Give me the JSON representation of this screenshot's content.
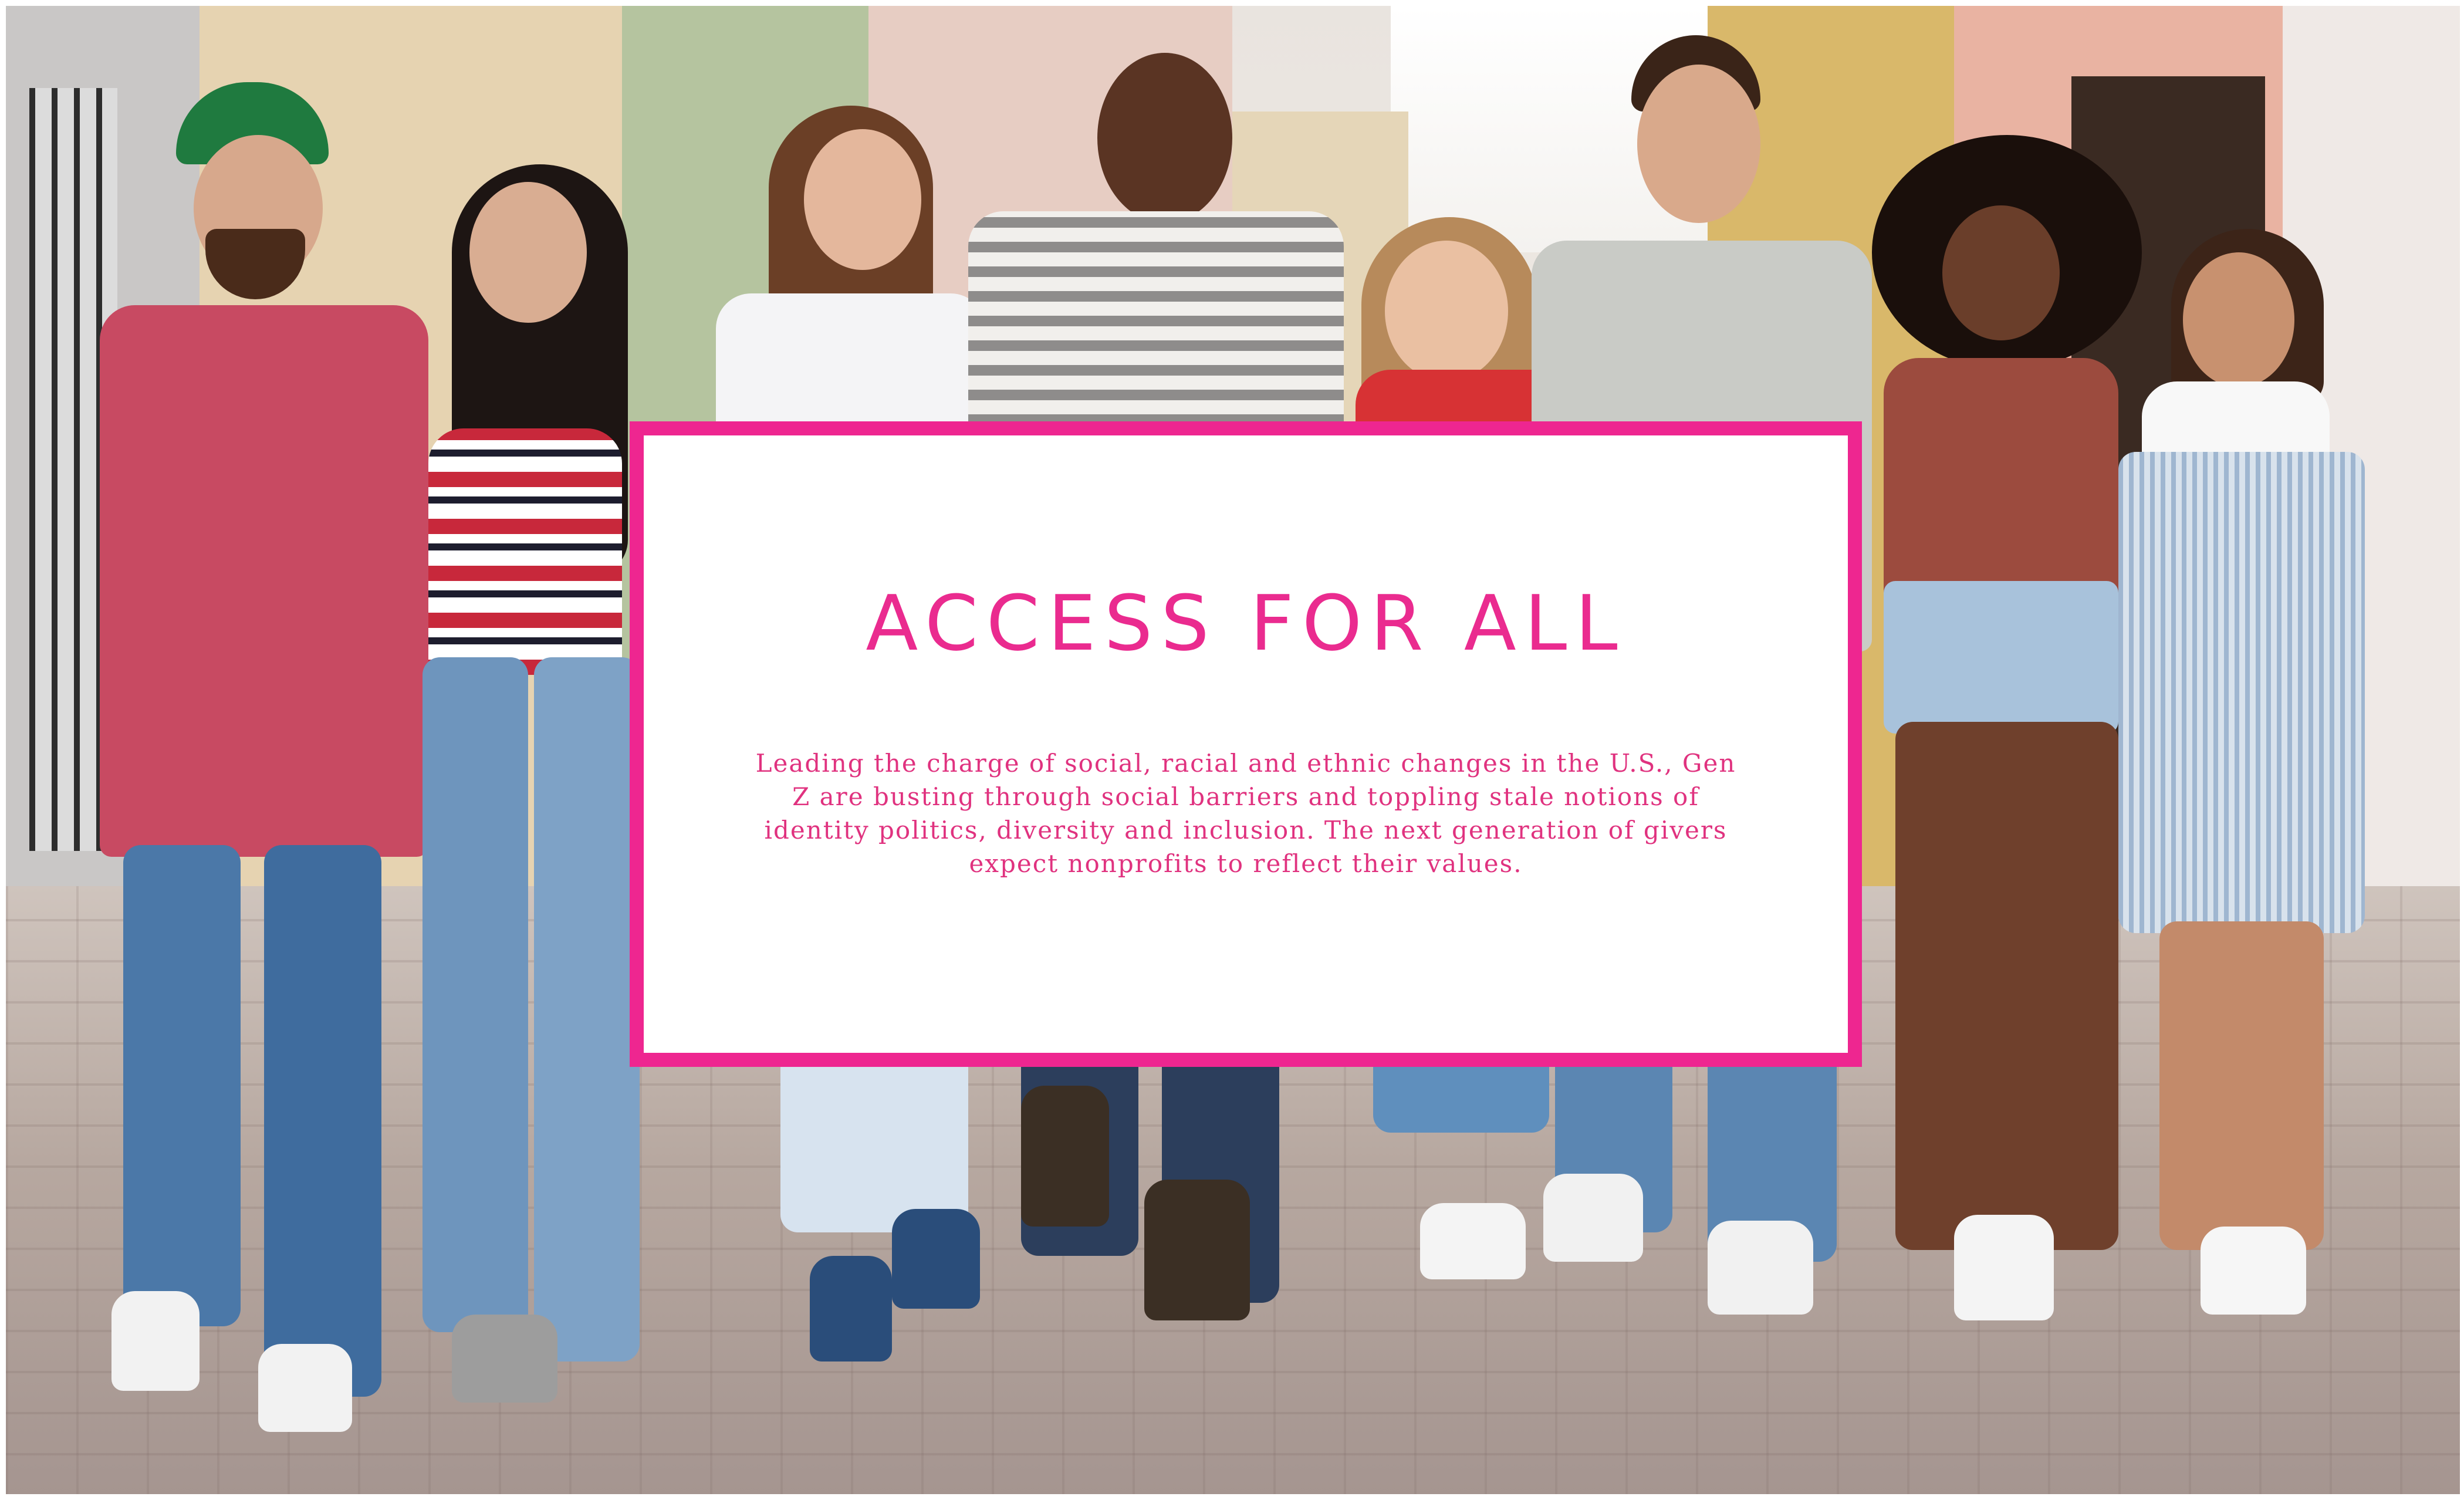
{
  "card": {
    "title": "ACCESS FOR ALL",
    "body": "Leading the charge of social, racial and ethnic changes in the U.S., Gen Z are busting through social barriers and toppling stale notions of identity politics, diversity and inclusion. The next generation of givers expect nonprofits to reflect their values."
  },
  "colors": {
    "accent": "#ee2690",
    "card_background": "#ffffff"
  }
}
